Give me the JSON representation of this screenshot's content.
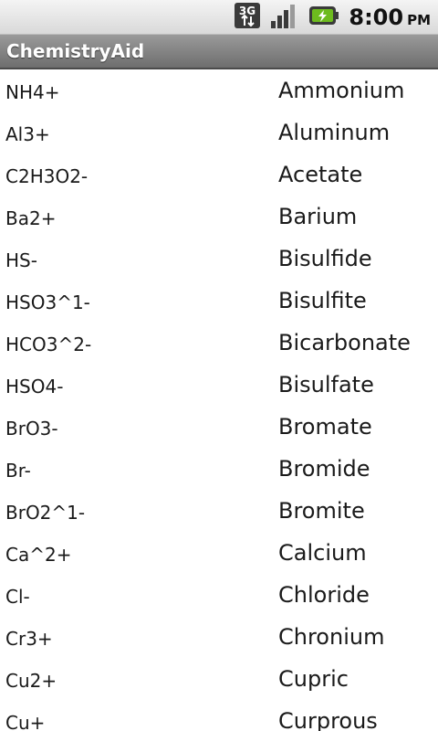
{
  "status_bar": {
    "network_label": "3G",
    "time": "8:00",
    "ampm": "PM",
    "icons": [
      "3g-data-icon",
      "signal-strength-icon",
      "battery-charging-icon"
    ],
    "battery_color": "#6dbb1e"
  },
  "app": {
    "title": "ChemistryAid"
  },
  "ions": [
    {
      "formula": "NH4+",
      "name": "Ammonium"
    },
    {
      "formula": "Al3+",
      "name": "Aluminum"
    },
    {
      "formula": "C2H3O2-",
      "name": "Acetate"
    },
    {
      "formula": "Ba2+",
      "name": "Barium"
    },
    {
      "formula": "HS-",
      "name": "Bisulfide"
    },
    {
      "formula": "HSO3^1-",
      "name": "Bisulfite"
    },
    {
      "formula": "HCO3^2-",
      "name": "Bicarbonate"
    },
    {
      "formula": "HSO4-",
      "name": "Bisulfate"
    },
    {
      "formula": "BrO3-",
      "name": "Bromate"
    },
    {
      "formula": "Br-",
      "name": "Bromide"
    },
    {
      "formula": "BrO2^1-",
      "name": "Bromite"
    },
    {
      "formula": "Ca^2+",
      "name": "Calcium"
    },
    {
      "formula": "Cl-",
      "name": "Chloride"
    },
    {
      "formula": "Cr3+",
      "name": "Chronium"
    },
    {
      "formula": "Cu2+",
      "name": "Cupric"
    },
    {
      "formula": "Cu+",
      "name": "Curprous"
    }
  ]
}
